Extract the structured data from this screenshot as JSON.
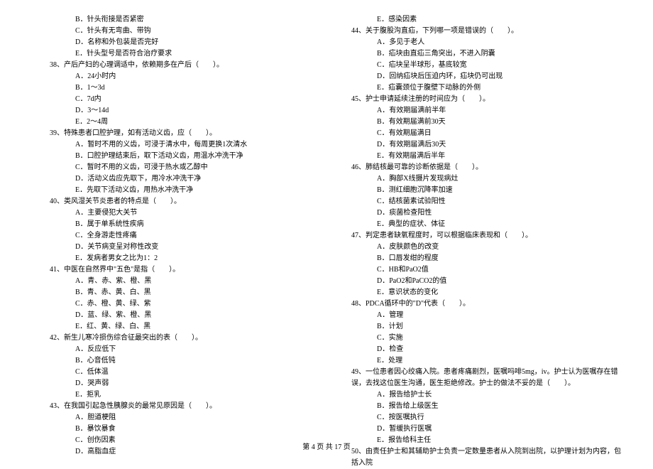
{
  "left": [
    {
      "cls": "option",
      "text": "B．针头衔接是否紧密"
    },
    {
      "cls": "option",
      "text": "C．针头有无弯曲、带钩"
    },
    {
      "cls": "option",
      "text": "D．名称和外包装是否完好"
    },
    {
      "cls": "option",
      "text": "E．针头型号是否符合治疗要求"
    },
    {
      "cls": "question",
      "text": "38、产后产妇的心理调适中，依赖期多在产后（　　）。"
    },
    {
      "cls": "option",
      "text": "A．24小时内"
    },
    {
      "cls": "option",
      "text": "B．1～3d"
    },
    {
      "cls": "option",
      "text": "C．7d内"
    },
    {
      "cls": "option",
      "text": "D．3～14d"
    },
    {
      "cls": "option",
      "text": "E．2～4周"
    },
    {
      "cls": "question",
      "text": "39、特殊患者口腔护理，如有活动义齿，应（　　）。"
    },
    {
      "cls": "option",
      "text": "A．暂时不用的义齿，可浸于清水中，每周更换1次清水"
    },
    {
      "cls": "option",
      "text": "B．口腔护理结束后，取下活动义齿，用温水冲洗干净"
    },
    {
      "cls": "option",
      "text": "C．暂时不用的义齿，可浸于热水或乙醇中"
    },
    {
      "cls": "option",
      "text": "D．活动义齿应先取下，用冷水冲洗干净"
    },
    {
      "cls": "option",
      "text": "E．先取下活动义齿，用热水冲洗干净"
    },
    {
      "cls": "question",
      "text": "40、类风湿关节炎患者的特点是（　　）。"
    },
    {
      "cls": "option",
      "text": "A．主要侵犯大关节"
    },
    {
      "cls": "option",
      "text": "B．属于单系统性疾病"
    },
    {
      "cls": "option",
      "text": "C．全身游走性疼痛"
    },
    {
      "cls": "option",
      "text": "D．关节病变呈对称性改变"
    },
    {
      "cls": "option",
      "text": "E．发病者男女之比为1：2"
    },
    {
      "cls": "question",
      "text": "41、中医在自然界中\"五色\"是指（　　）。"
    },
    {
      "cls": "option",
      "text": "A．青、赤、紫、橙、黑"
    },
    {
      "cls": "option",
      "text": "B．青、赤、黄、白、黑"
    },
    {
      "cls": "option",
      "text": "C．赤、橙、黄、绿、紫"
    },
    {
      "cls": "option",
      "text": "D．蓝、绿、紫、橙、黑"
    },
    {
      "cls": "option",
      "text": "E．红、黄、绿、白、黑"
    },
    {
      "cls": "question",
      "text": "42、新生儿寒冷损伤综合征最突出的表（　　）。"
    },
    {
      "cls": "option",
      "text": "A．反应低下"
    },
    {
      "cls": "option",
      "text": "B．心音低钝"
    },
    {
      "cls": "option",
      "text": "C．低体温"
    },
    {
      "cls": "option",
      "text": "D．哭声弱"
    },
    {
      "cls": "option",
      "text": "E．拒乳"
    },
    {
      "cls": "question",
      "text": "43、在我国引起急性胰腺炎的最常见原因是（　　）。"
    },
    {
      "cls": "option",
      "text": "A．胆道梗阻"
    },
    {
      "cls": "option",
      "text": "B．暴饮暴食"
    },
    {
      "cls": "option",
      "text": "C．创伤因素"
    },
    {
      "cls": "option",
      "text": "D．高脂血症"
    }
  ],
  "right": [
    {
      "cls": "option",
      "text": "E．感染因素"
    },
    {
      "cls": "question",
      "text": "44、关于腹股沟直疝，下列哪一项是错误的（　　）。"
    },
    {
      "cls": "option",
      "text": "A．多见于老人"
    },
    {
      "cls": "option",
      "text": "B．疝块由直疝三角突出，不进入阴囊"
    },
    {
      "cls": "option",
      "text": "C．疝块呈半球形，基底较宽"
    },
    {
      "cls": "option",
      "text": "D．回纳疝块后压迫内环，疝块仍可出现"
    },
    {
      "cls": "option",
      "text": "E．疝囊颈位于腹壁下动脉的外侧"
    },
    {
      "cls": "question",
      "text": "45、护士申请延续注册的时间应为（　　）。"
    },
    {
      "cls": "option",
      "text": "A．有效期届满前半年"
    },
    {
      "cls": "option",
      "text": "B．有效期届满前30天"
    },
    {
      "cls": "option",
      "text": "C．有效期届满日"
    },
    {
      "cls": "option",
      "text": "D．有效期届满后30天"
    },
    {
      "cls": "option",
      "text": "E．有效期届满后半年"
    },
    {
      "cls": "question",
      "text": "46、肺结核最可靠的诊断依据是（　　）。"
    },
    {
      "cls": "option",
      "text": "A．胸部X线摄片发现病灶"
    },
    {
      "cls": "option",
      "text": "B．测红细胞沉降率加速"
    },
    {
      "cls": "option",
      "text": "C．结核菌素试验阳性"
    },
    {
      "cls": "option",
      "text": "D．痰菌检查阳性"
    },
    {
      "cls": "option",
      "text": "E．典型的症状、体征"
    },
    {
      "cls": "question",
      "text": "47、判定患者缺氧程度时，可以根据临床表现和（　　）。"
    },
    {
      "cls": "option",
      "text": "A．皮肤颜色的改变"
    },
    {
      "cls": "option",
      "text": "B．口唇发绀的程度"
    },
    {
      "cls": "option",
      "text": "C．HB和PaO2值"
    },
    {
      "cls": "option",
      "text": "D．PaO2和PaCO2的值"
    },
    {
      "cls": "option",
      "text": "E．意识状态的变化"
    },
    {
      "cls": "question",
      "text": "48、PDCA循环中的\"D\"代表（　　）。"
    },
    {
      "cls": "option",
      "text": "A．管理"
    },
    {
      "cls": "option",
      "text": "B．计划"
    },
    {
      "cls": "option",
      "text": "C．实施"
    },
    {
      "cls": "option",
      "text": "D．检查"
    },
    {
      "cls": "option",
      "text": "E．处理"
    },
    {
      "cls": "question",
      "text": "49、一位患者因心绞痛入院。患者疼痛剧烈，医嘱吗啡5mg，iv。护士认为医嘱存在错误，去找这位医生沟通，医生拒绝修改。护士的做法不妥的是（　　）。"
    },
    {
      "cls": "option",
      "text": "A．报告给护士长"
    },
    {
      "cls": "option",
      "text": "B．报告给上级医生"
    },
    {
      "cls": "option",
      "text": "C．按医嘱执行"
    },
    {
      "cls": "option",
      "text": "D．暂缓执行医嘱"
    },
    {
      "cls": "option",
      "text": "E．报告给科主任"
    },
    {
      "cls": "question",
      "text": "50、由责任护士和其辅助护士负责一定数量患者从入院到出院，以护理计划为内容，包括入院"
    }
  ],
  "footer": "第 4 页 共 17 页"
}
